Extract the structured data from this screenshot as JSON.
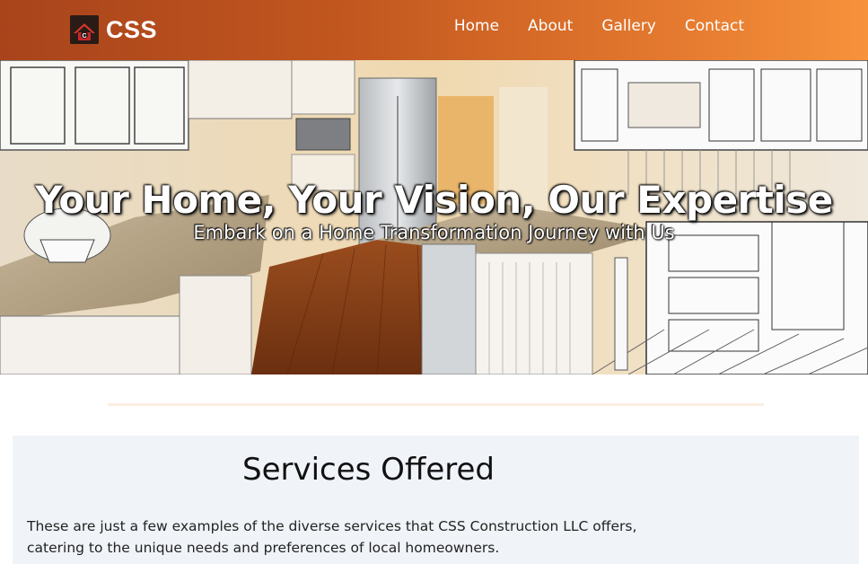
{
  "header": {
    "brand": "CSS",
    "logo_letter": "C",
    "nav": [
      {
        "label": "Home"
      },
      {
        "label": "About"
      },
      {
        "label": "Gallery"
      },
      {
        "label": "Contact"
      }
    ],
    "gradient_start": "#a8431b",
    "gradient_end": "#f7923b"
  },
  "hero": {
    "title": "Your Home, Your Vision, Our Expertise",
    "subtitle": "Embark on a Home Transformation Journey with Us"
  },
  "services": {
    "heading": "Services Offered",
    "description": "These are just a few examples of the diverse services that CSS Construction LLC offers, catering to the unique needs and preferences of local homeowners."
  }
}
